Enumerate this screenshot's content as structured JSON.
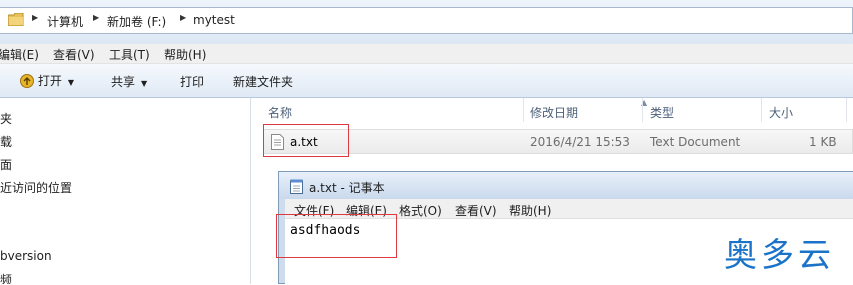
{
  "address_bar": {
    "crumbs": [
      "计算机",
      "新加卷 (F:)",
      "mytest"
    ]
  },
  "menu": [
    "编辑(E)",
    "查看(V)",
    "工具(T)",
    "帮助(H)"
  ],
  "toolbar": {
    "open_label": "打开",
    "share_label": "共享",
    "print_label": "打印",
    "new_folder_label": "新建文件夹"
  },
  "nav": [
    "夹",
    "载",
    "面",
    "近访问的位置",
    "bversion",
    "频"
  ],
  "columns": {
    "name": "名称",
    "modified": "修改日期",
    "type": "类型",
    "size": "大小"
  },
  "file": {
    "name": "a.txt",
    "modified": "2016/4/21 15:53",
    "type": "Text Document",
    "size": "1 KB"
  },
  "notepad": {
    "title": "a.txt - 记事本",
    "menu": [
      "文件(F)",
      "编辑(E)",
      "格式(O)",
      "查看(V)",
      "帮助(H)"
    ],
    "content": "asdfhaods"
  },
  "watermark": "奥多云",
  "colors": {
    "highlight_border": "#e0393e",
    "watermark": "#1a73c8"
  }
}
